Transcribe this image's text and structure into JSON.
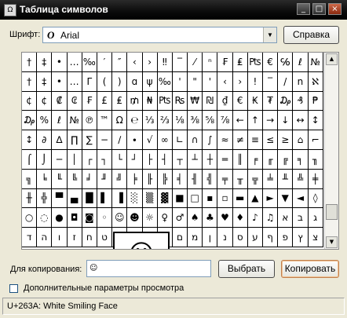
{
  "window": {
    "title": "Таблица символов",
    "app_icon": "charmap-icon",
    "controls": [
      "_",
      "□",
      "×"
    ]
  },
  "font": {
    "label": "Шрифт:",
    "icon": "opentype-icon",
    "icon_glyph": "O",
    "value": "Arial",
    "dropdown_glyph": "▼"
  },
  "help_button": "Справка",
  "grid": {
    "rows": [
      [
        "†",
        "‡",
        "•",
        "…",
        "‰",
        "′",
        "″",
        "‹",
        "›",
        "‼",
        "‾",
        "⁄",
        "ⁿ",
        "₣",
        "₤",
        "₧",
        "€",
        "℅",
        "ℓ",
        "№"
      ],
      [
        "†",
        "‡",
        "•",
        "…",
        "Γ",
        "(",
        ")",
        "ɑ",
        "ψ",
        "‰",
        "'",
        "\"",
        "'",
        "‹",
        "›",
        "!",
        "‾",
        "/",
        "n",
        "ℵ"
      ],
      [
        "¢",
        "¢",
        "₡",
        "₢",
        "₣",
        "£",
        "₤",
        "₥",
        "₦",
        "₧",
        "₨",
        "₩",
        "₪",
        "₫",
        "€",
        "₭",
        "₮",
        "₯",
        "₰",
        "₱"
      ],
      [
        "₯",
        "%",
        "ℓ",
        "№",
        "℗",
        "™",
        "Ω",
        "℮",
        "⅓",
        "⅔",
        "⅛",
        "⅜",
        "⅝",
        "⅞",
        "←",
        "↑",
        "→",
        "↓",
        "↔",
        "↕"
      ],
      [
        "↕",
        "∂",
        "∆",
        "∏",
        "∑",
        "−",
        "∕",
        "∙",
        "√",
        "∞",
        "∟",
        "∩",
        "∫",
        "≈",
        "≠",
        "≡",
        "≤",
        "≥",
        "⌂",
        "⌐"
      ],
      [
        "⌠",
        "⌡",
        "─",
        "│",
        "┌",
        "┐",
        "└",
        "┘",
        "├",
        "┤",
        "┬",
        "┴",
        "┼",
        "═",
        "║",
        "╒",
        "╓",
        "╔",
        "╕",
        "╖"
      ],
      [
        "╗",
        "╘",
        "╙",
        "╚",
        "╛",
        "╜",
        "╝",
        "╞",
        "╟",
        "╠",
        "╡",
        "╢",
        "╣",
        "╤",
        "╥",
        "╦",
        "╧",
        "╨",
        "╩",
        "╪"
      ],
      [
        "╫",
        "╬",
        "▀",
        "▄",
        "█",
        "▌",
        "▐",
        "░",
        "▒",
        "▓",
        "■",
        "□",
        "▪",
        "▫",
        "▬",
        "▲",
        "►",
        "▼",
        "◄",
        "◊"
      ],
      [
        "○",
        "◌",
        "●",
        "◘",
        "◙",
        "◦",
        "☺",
        "☻",
        "☼",
        "♀",
        "♂",
        "♠",
        "♣",
        "♥",
        "♦",
        "♪",
        "♫",
        "א",
        "ב",
        "ג"
      ],
      [
        "ד",
        "ה",
        "ו",
        "ז",
        "ח",
        "ט",
        "י",
        "ך",
        "כ",
        "ל",
        "ם",
        "מ",
        "ן",
        "נ",
        "ס",
        "ע",
        "ף",
        "פ",
        "ץ",
        "צ"
      ]
    ],
    "zoomed_char": "☺",
    "scroll_up": "▲",
    "scroll_down": "▼"
  },
  "copy": {
    "label": "Для копирования:",
    "value": "☺",
    "select_button": "Выбрать",
    "copy_button": "Копировать"
  },
  "advanced": {
    "label": "Дополнительные параметры просмотра",
    "checked": false
  },
  "status": "U+263A: White Smiling Face"
}
